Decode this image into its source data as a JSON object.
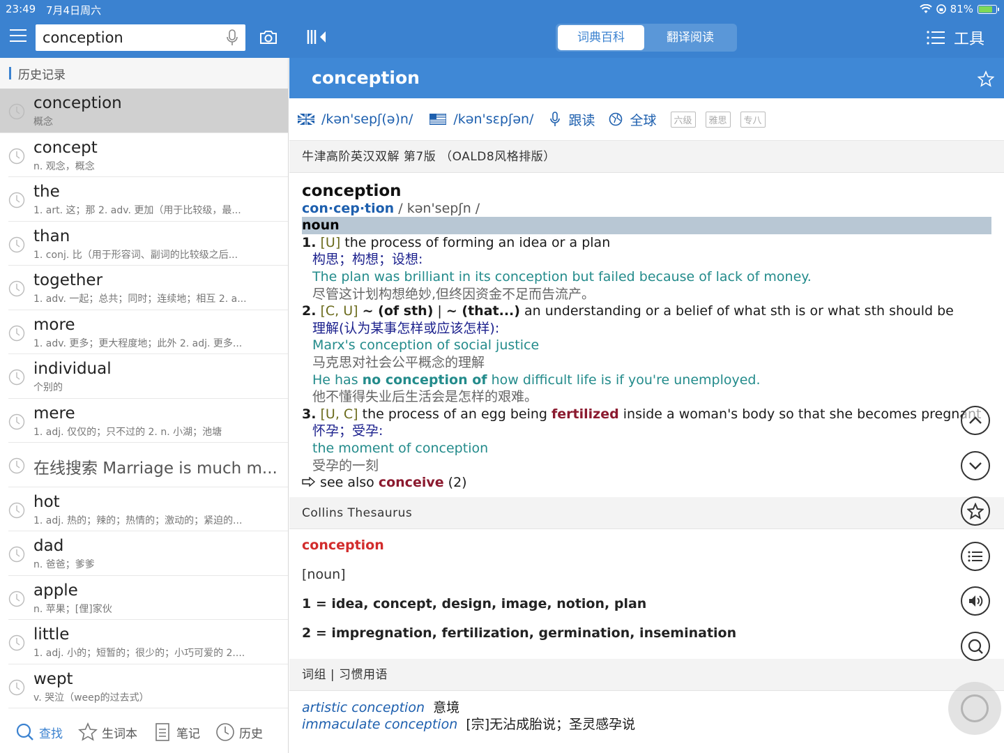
{
  "status": {
    "time": "23:49",
    "date": "7月4日周六",
    "battery_pct_text": "81%",
    "battery_level": 0.81
  },
  "search": {
    "value": "conception"
  },
  "segment": {
    "tab1": "词典百科",
    "tab2": "翻译阅读"
  },
  "tools_label": "工具",
  "history": {
    "header": "历史记录",
    "items": [
      {
        "word": "conception",
        "def": "概念"
      },
      {
        "word": "concept",
        "def": "n. 观念，概念"
      },
      {
        "word": "the",
        "def": "1. art. 这；那 2. adv. 更加（用于比较级，最..."
      },
      {
        "word": "than",
        "def": "1. conj. 比（用于形容词、副词的比较级之后..."
      },
      {
        "word": "together",
        "def": "1. adv. 一起；总共；同时；连续地；相互 2. a..."
      },
      {
        "word": "more",
        "def": "1. adv. 更多；更大程度地；此外 2. adj. 更多..."
      },
      {
        "word": "individual",
        "def": "个别的"
      },
      {
        "word": "mere",
        "def": "1. adj. 仅仅的；只不过的 2. n. 小湖；池塘"
      },
      {
        "word": "在线搜索 Marriage is much m...",
        "def": ""
      },
      {
        "word": "hot",
        "def": "1. adj. 热的；辣的；热情的；激动的；紧迫的..."
      },
      {
        "word": "dad",
        "def": "n. 爸爸；爹爹"
      },
      {
        "word": "apple",
        "def": "n. 苹果；[俚]家伙"
      },
      {
        "word": "little",
        "def": "1. adj. 小的；短暂的；很少的；小巧可爱的 2...."
      },
      {
        "word": "wept",
        "def": "v. 哭泣（weep的过去式）"
      }
    ]
  },
  "bottom_tabs": {
    "search": "查找",
    "vocab": "生词本",
    "notes": "笔记",
    "history": "历史"
  },
  "entry": {
    "headword": "conception",
    "pron_uk": "/kən'sepʃ(ə)n/",
    "pron_us": "/kən'sɛpʃən/",
    "follow_read": "跟读",
    "global": "全球",
    "tags": [
      "六级",
      "雅思",
      "专八"
    ],
    "oald_header": "牛津高阶英汉双解 第7版 （OALD8风格排版）",
    "title": "conception",
    "syll1": "con",
    "syll2": "cep",
    "syll3": "tion",
    "phonetic": "/ kən'sepʃn /",
    "pos": "noun",
    "s1_num": "1.",
    "s1_gram": "[U]",
    "s1_def": " the process of forming an idea or a plan",
    "s1_cn": "构思；构想；设想:",
    "s1_ex_en": "The plan was brilliant in its conception but failed because of lack of money.",
    "s1_ex_cn": "尽管这计划构想绝妙,但终因资金不足而告流产。",
    "s2_num": "2.",
    "s2_gram": "[C, U]",
    "s2_pattern": "~ (of sth)",
    "s2_sep": " | ",
    "s2_pattern2": "~ (that...)",
    "s2_def": " an understanding or a belief of what sth is or what sth should be",
    "s2_cn": "理解(认为某事怎样或应该怎样):",
    "s2_ex1_en": "Marx's conception of social justice",
    "s2_ex1_cn": "马克思对社会公平概念的理解",
    "s2_ex2_pre": "He has ",
    "s2_ex2_bold": "no conception of",
    "s2_ex2_post": " how difficult life is if you're unemployed.",
    "s2_ex2_cn": "他不懂得失业后生活会是怎样的艰难。",
    "s3_num": "3.",
    "s3_gram": "[U, C]",
    "s3_def_pre": " the process of an egg being ",
    "s3_def_bold": "fertilized",
    "s3_def_post": " inside a woman's body so that she becomes pregnant",
    "s3_cn": "怀孕；受孕:",
    "s3_ex_en": "the moment of conception",
    "s3_ex_cn": "受孕的一刻",
    "see_also_pre": " see also ",
    "see_also_word": "conceive",
    "see_also_num": " (2)",
    "collins_header": "Collins Thesaurus",
    "collins_hw": "conception",
    "collins_pos": "[noun]",
    "collins_1_num": "1 = ",
    "collins_1_words": "idea, concept, design, image, notion, plan",
    "collins_2_num": "2 = ",
    "collins_2_words": "impregnation, fertilization, germination, insemination",
    "phrases_header": "词组 | 习惯用语",
    "phrase1_en": "artistic conception",
    "phrase1_cn": "意境",
    "phrase2_en": "immaculate conception",
    "phrase2_cn": "[宗]无沾成胎说；圣灵感孕说"
  },
  "colors": {
    "accent": "#3b82d0",
    "header_blue": "#3f88d6",
    "example_teal": "#238b8b",
    "xref": "#8b1a2f"
  }
}
